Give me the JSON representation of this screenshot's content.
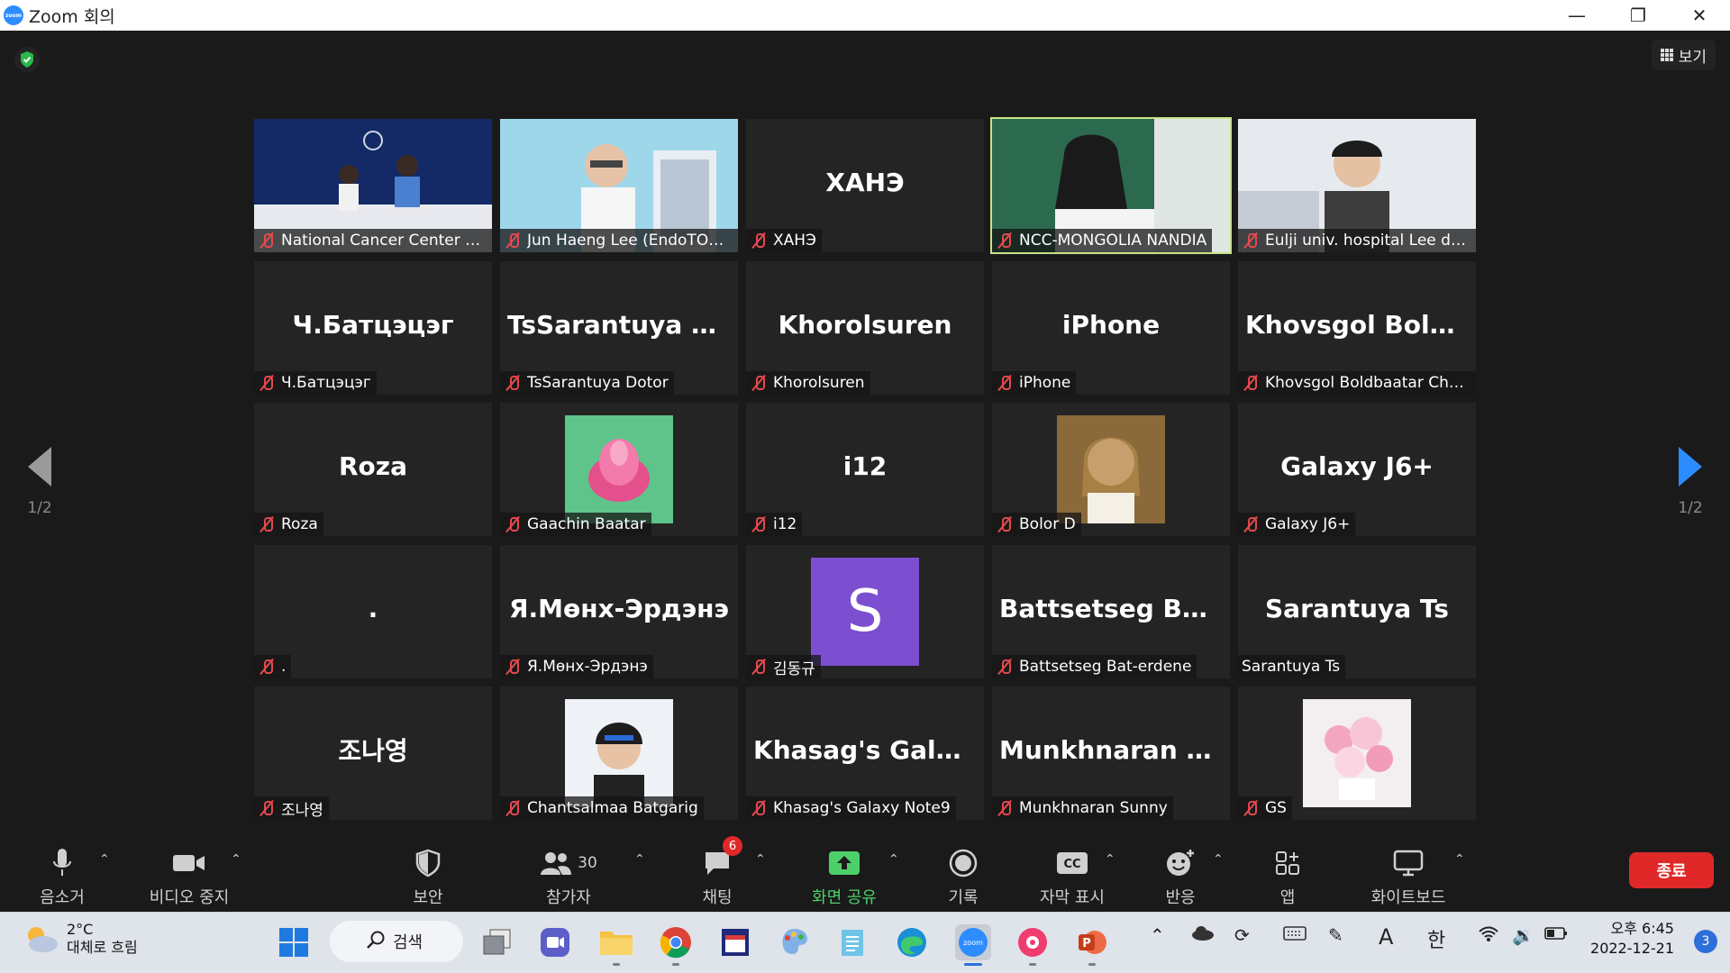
{
  "window": {
    "title": "Zoom 회의",
    "view_label": "보기"
  },
  "pager": {
    "left": "1/2",
    "right": "1/2"
  },
  "tiles": [
    {
      "big": "",
      "label": "National Cancer Center o...",
      "kind": "video"
    },
    {
      "big": "",
      "label": "Jun Haeng Lee (EndoTODAY)",
      "kind": "video"
    },
    {
      "big": "ХАНЭ",
      "label": "ХАНЭ",
      "kind": "name"
    },
    {
      "big": "",
      "label": "NCC-MONGOLIA NANDIA",
      "kind": "video"
    },
    {
      "big": "",
      "label": "Eulji univ. hospital Lee dong ...",
      "kind": "video"
    },
    {
      "big": "Ч.Батцэцэг",
      "label": "Ч.Батцэцэг",
      "kind": "name"
    },
    {
      "big": "TsSarantuya Do...",
      "label": "TsSarantuya Dotor",
      "kind": "name"
    },
    {
      "big": "Khorolsuren",
      "label": "Khorolsuren",
      "kind": "name"
    },
    {
      "big": "iPhone",
      "label": "iPhone",
      "kind": "name"
    },
    {
      "big": "Khovsgol Boldb...",
      "label": "Khovsgol Boldbaatar Cho...",
      "kind": "name"
    },
    {
      "big": "Roza",
      "label": "Roza",
      "kind": "name"
    },
    {
      "big": "",
      "label": "Gaachin Baatar",
      "kind": "avatar"
    },
    {
      "big": "i12",
      "label": "i12",
      "kind": "name"
    },
    {
      "big": "",
      "label": "Bolor D",
      "kind": "avatar"
    },
    {
      "big": "Galaxy J6+",
      "label": "Galaxy J6+",
      "kind": "name"
    },
    {
      "big": ".",
      "label": ".",
      "kind": "name"
    },
    {
      "big": "Я.Мөнх-Эрдэнэ",
      "label": "Я.Мөнх-Эрдэнэ",
      "kind": "name"
    },
    {
      "big": "",
      "label": "김동규",
      "kind": "letter",
      "letter": "S"
    },
    {
      "big": "Battsetseg Bat-...",
      "label": "Battsetseg Bat-erdene",
      "kind": "name"
    },
    {
      "big": "Sarantuya Ts",
      "label": "Sarantuya Ts",
      "kind": "name",
      "unmuted": true
    },
    {
      "big": "조나영",
      "label": "조나영",
      "kind": "name"
    },
    {
      "big": "",
      "label": "Chantsalmaa Batgarig",
      "kind": "avatar"
    },
    {
      "big": "Khasag's Galaxy...",
      "label": "Khasag's Galaxy Note9",
      "kind": "name"
    },
    {
      "big": "Munkhnaran Su...",
      "label": "Munkhnaran Sunny",
      "kind": "name"
    },
    {
      "big": "",
      "label": "GS",
      "kind": "avatar"
    }
  ],
  "toolbar": {
    "audio": "음소거",
    "video": "비디오 중지",
    "security": "보안",
    "participants": "참가자",
    "participants_count": "30",
    "chat": "채팅",
    "chat_badge": "6",
    "share": "화면 공유",
    "record": "기록",
    "captions": "자막 표시",
    "reactions": "반응",
    "apps": "앱",
    "whiteboard": "화이트보드",
    "end": "종료",
    "share_color": "#4dd06a",
    "end_color": "#e02828"
  },
  "taskbar": {
    "weather_temp": "2°C",
    "weather_desc": "대체로 흐림",
    "search": "검색",
    "ime_a": "A",
    "ime_han": "한",
    "time": "오후 6:45",
    "date": "2022-12-21",
    "notifications": "3"
  }
}
